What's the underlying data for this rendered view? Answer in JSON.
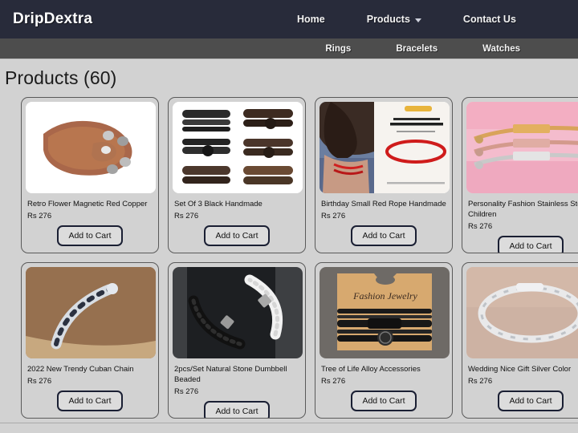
{
  "header": {
    "brand": "DripDextra",
    "nav": [
      {
        "label": "Home",
        "icon": null
      },
      {
        "label": "Products",
        "icon": "chevron-down-icon"
      },
      {
        "label": "Contact Us",
        "icon": null
      }
    ],
    "submenu": [
      {
        "label": "Rings"
      },
      {
        "label": "Bracelets"
      },
      {
        "label": "Watches"
      }
    ],
    "colors": {
      "navbar_bg": "#282b3a",
      "submenu_bg": "#4d4d4d",
      "page_bg": "#d2d2d2",
      "button_border": "#1a1f33"
    }
  },
  "main": {
    "title": "Products (60)",
    "product_count": 60,
    "cart_button_label": "Add to Cart",
    "products": [
      {
        "name": "Retro Flower Magnetic Red Copper",
        "price": "Rs 276",
        "image": "copper-magnetic-bangle"
      },
      {
        "name": "Set Of 3 Black Handmade",
        "price": "Rs 276",
        "image": "black-leather-bracelet-set"
      },
      {
        "name": "Birthday Small Red Rope Handmade",
        "price": "Rs 276",
        "image": "red-rope-bracelet"
      },
      {
        "name": "Personality Fashion Stainless Steel Children",
        "price": "Rs 276",
        "image": "pink-id-bracelets"
      },
      {
        "name": "2022 New Trendy Cuban Chain",
        "price": "Rs 276",
        "image": "cuban-chain-on-wrist"
      },
      {
        "name": "2pcs/Set Natural Stone Dumbbell Beaded",
        "price": "Rs 276",
        "image": "black-white-beaded-pair"
      },
      {
        "name": "Tree of Life Alloy Accessories",
        "price": "Rs 276",
        "image": "tree-of-life-card"
      },
      {
        "name": "Wedding Nice Gift Silver Color",
        "price": "Rs 276",
        "image": "silver-figaro-chain"
      }
    ]
  }
}
